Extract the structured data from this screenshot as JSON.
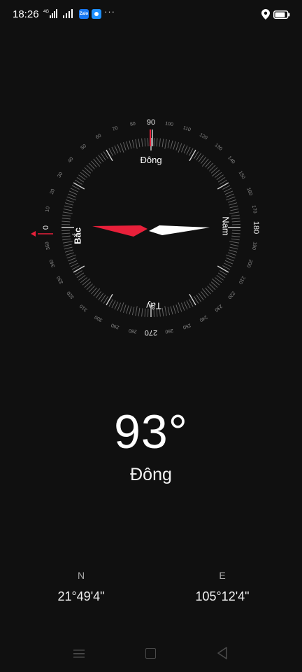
{
  "status_bar": {
    "time": "18:26",
    "network_label": "4G",
    "icons": [
      "signal-icon",
      "signal-icon",
      "zalo-icon",
      "messenger-icon",
      "more-icon",
      "location-icon",
      "battery-icon"
    ],
    "zalo_label": "Zalo",
    "more": "···"
  },
  "compass": {
    "cardinal": {
      "north": "Bắc",
      "east": "Đông",
      "south": "Nam",
      "west": "Tây"
    },
    "ticks": [
      "0",
      "10",
      "20",
      "30",
      "40",
      "50",
      "60",
      "70",
      "80",
      "90",
      "100",
      "110",
      "120",
      "130",
      "140",
      "150",
      "160",
      "170",
      "180",
      "190",
      "200",
      "210",
      "220",
      "230",
      "240",
      "250",
      "260",
      "270",
      "280",
      "290",
      "300",
      "310",
      "320",
      "330",
      "340",
      "350"
    ],
    "heading_deg": 93,
    "accent_color": "#e8203a"
  },
  "readout": {
    "heading": "93°",
    "direction": "Đông"
  },
  "coordinates": {
    "lat_label": "N",
    "lat_value": "21°49'4\"",
    "lon_label": "E",
    "lon_value": "105°12'4\""
  },
  "nav_bar": {
    "icons": [
      "menu-icon",
      "home-icon",
      "back-icon"
    ]
  }
}
